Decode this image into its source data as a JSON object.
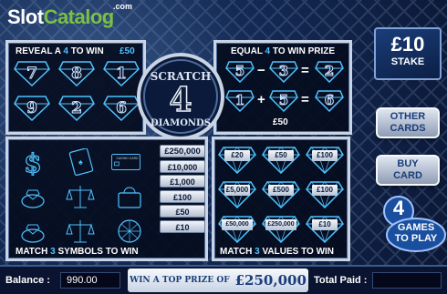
{
  "logo": {
    "part1": "Slot",
    "part2": "Catalog",
    "suffix": ".com"
  },
  "game_title": {
    "line1": "SCRATCH",
    "number": "4",
    "line2": "DIAMONDS"
  },
  "panel1": {
    "title_pre": "REVEAL A ",
    "title_hl": "4",
    "title_post": " TO WIN",
    "prize": "£50",
    "numbers": [
      "7",
      "8",
      "1",
      "9",
      "2",
      "6"
    ]
  },
  "panel2": {
    "title_pre": "EQUAL ",
    "title_hl": "4",
    "title_post": " TO WIN PRIZE",
    "row1": {
      "a": "5",
      "op": "−",
      "b": "3",
      "eq": "=",
      "result": "2"
    },
    "row2": {
      "a": "1",
      "op": "+",
      "b": "5",
      "eq": "=",
      "result": "6"
    },
    "prize": "£50"
  },
  "panel3": {
    "title_pre": "MATCH ",
    "title_hl": "3",
    "title_post": " SYMBOLS TO WIN",
    "symbols": [
      "dollar-sign-icon",
      "playing-card-icon",
      "credit-card-icon",
      "ring-icon",
      "scales-icon",
      "handbag-icon",
      "ring-icon",
      "scales-icon",
      "diamond-ball-icon"
    ],
    "card_text": "CASINO CARD",
    "prizes": [
      "£250,000",
      "£10,000",
      "£1,000",
      "£100",
      "£50",
      "£10"
    ]
  },
  "panel4": {
    "title_pre": "MATCH ",
    "title_hl": "3",
    "title_post": " VALUES TO WIN",
    "values": [
      "£20",
      "£50",
      "£100",
      "£5,000",
      "£500",
      "£100",
      "£50,000",
      "£250,000",
      "£10"
    ]
  },
  "stake": {
    "amount": "£10",
    "label": "STAKE"
  },
  "buttons": {
    "other_line1": "OTHER",
    "other_line2": "CARDS",
    "buy_line1": "BUY",
    "buy_line2": "CARD"
  },
  "games_badge": {
    "number": "4",
    "line1": "GAMES",
    "line2": "TO PLAY"
  },
  "bottom": {
    "balance_label": "Balance :",
    "balance_value": "990.00",
    "promo_text": "WIN A TOP PRIZE OF",
    "promo_amount": "£250,000",
    "total_paid_label": "Total Paid :",
    "total_paid_value": ""
  },
  "colors": {
    "accent": "#4fc3ff",
    "logo_green": "#7bc043",
    "panel_border": "#c9d4e4",
    "background": "#142a55"
  }
}
